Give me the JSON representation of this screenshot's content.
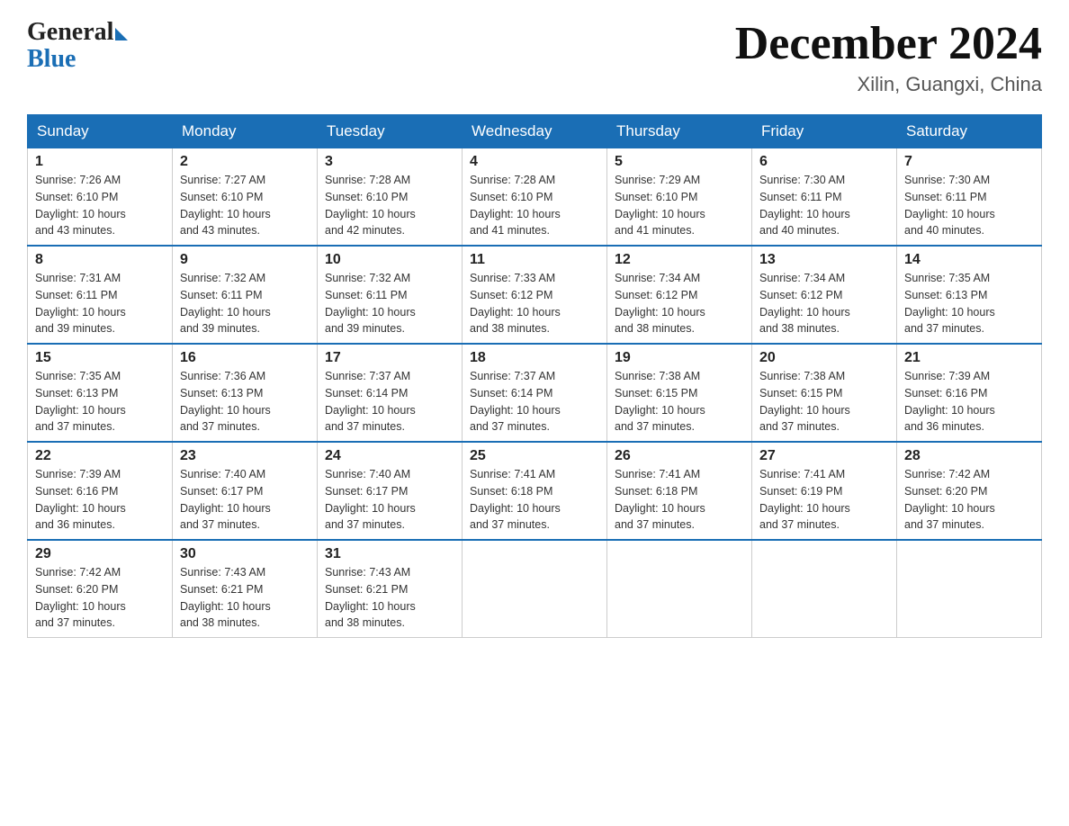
{
  "header": {
    "logo_general": "General",
    "logo_blue": "Blue",
    "month_title": "December 2024",
    "location": "Xilin, Guangxi, China"
  },
  "weekdays": [
    "Sunday",
    "Monday",
    "Tuesday",
    "Wednesday",
    "Thursday",
    "Friday",
    "Saturday"
  ],
  "weeks": [
    [
      {
        "day": "1",
        "sunrise": "7:26 AM",
        "sunset": "6:10 PM",
        "daylight": "10 hours and 43 minutes."
      },
      {
        "day": "2",
        "sunrise": "7:27 AM",
        "sunset": "6:10 PM",
        "daylight": "10 hours and 43 minutes."
      },
      {
        "day": "3",
        "sunrise": "7:28 AM",
        "sunset": "6:10 PM",
        "daylight": "10 hours and 42 minutes."
      },
      {
        "day": "4",
        "sunrise": "7:28 AM",
        "sunset": "6:10 PM",
        "daylight": "10 hours and 41 minutes."
      },
      {
        "day": "5",
        "sunrise": "7:29 AM",
        "sunset": "6:10 PM",
        "daylight": "10 hours and 41 minutes."
      },
      {
        "day": "6",
        "sunrise": "7:30 AM",
        "sunset": "6:11 PM",
        "daylight": "10 hours and 40 minutes."
      },
      {
        "day": "7",
        "sunrise": "7:30 AM",
        "sunset": "6:11 PM",
        "daylight": "10 hours and 40 minutes."
      }
    ],
    [
      {
        "day": "8",
        "sunrise": "7:31 AM",
        "sunset": "6:11 PM",
        "daylight": "10 hours and 39 minutes."
      },
      {
        "day": "9",
        "sunrise": "7:32 AM",
        "sunset": "6:11 PM",
        "daylight": "10 hours and 39 minutes."
      },
      {
        "day": "10",
        "sunrise": "7:32 AM",
        "sunset": "6:11 PM",
        "daylight": "10 hours and 39 minutes."
      },
      {
        "day": "11",
        "sunrise": "7:33 AM",
        "sunset": "6:12 PM",
        "daylight": "10 hours and 38 minutes."
      },
      {
        "day": "12",
        "sunrise": "7:34 AM",
        "sunset": "6:12 PM",
        "daylight": "10 hours and 38 minutes."
      },
      {
        "day": "13",
        "sunrise": "7:34 AM",
        "sunset": "6:12 PM",
        "daylight": "10 hours and 38 minutes."
      },
      {
        "day": "14",
        "sunrise": "7:35 AM",
        "sunset": "6:13 PM",
        "daylight": "10 hours and 37 minutes."
      }
    ],
    [
      {
        "day": "15",
        "sunrise": "7:35 AM",
        "sunset": "6:13 PM",
        "daylight": "10 hours and 37 minutes."
      },
      {
        "day": "16",
        "sunrise": "7:36 AM",
        "sunset": "6:13 PM",
        "daylight": "10 hours and 37 minutes."
      },
      {
        "day": "17",
        "sunrise": "7:37 AM",
        "sunset": "6:14 PM",
        "daylight": "10 hours and 37 minutes."
      },
      {
        "day": "18",
        "sunrise": "7:37 AM",
        "sunset": "6:14 PM",
        "daylight": "10 hours and 37 minutes."
      },
      {
        "day": "19",
        "sunrise": "7:38 AM",
        "sunset": "6:15 PM",
        "daylight": "10 hours and 37 minutes."
      },
      {
        "day": "20",
        "sunrise": "7:38 AM",
        "sunset": "6:15 PM",
        "daylight": "10 hours and 37 minutes."
      },
      {
        "day": "21",
        "sunrise": "7:39 AM",
        "sunset": "6:16 PM",
        "daylight": "10 hours and 36 minutes."
      }
    ],
    [
      {
        "day": "22",
        "sunrise": "7:39 AM",
        "sunset": "6:16 PM",
        "daylight": "10 hours and 36 minutes."
      },
      {
        "day": "23",
        "sunrise": "7:40 AM",
        "sunset": "6:17 PM",
        "daylight": "10 hours and 37 minutes."
      },
      {
        "day": "24",
        "sunrise": "7:40 AM",
        "sunset": "6:17 PM",
        "daylight": "10 hours and 37 minutes."
      },
      {
        "day": "25",
        "sunrise": "7:41 AM",
        "sunset": "6:18 PM",
        "daylight": "10 hours and 37 minutes."
      },
      {
        "day": "26",
        "sunrise": "7:41 AM",
        "sunset": "6:18 PM",
        "daylight": "10 hours and 37 minutes."
      },
      {
        "day": "27",
        "sunrise": "7:41 AM",
        "sunset": "6:19 PM",
        "daylight": "10 hours and 37 minutes."
      },
      {
        "day": "28",
        "sunrise": "7:42 AM",
        "sunset": "6:20 PM",
        "daylight": "10 hours and 37 minutes."
      }
    ],
    [
      {
        "day": "29",
        "sunrise": "7:42 AM",
        "sunset": "6:20 PM",
        "daylight": "10 hours and 37 minutes."
      },
      {
        "day": "30",
        "sunrise": "7:43 AM",
        "sunset": "6:21 PM",
        "daylight": "10 hours and 38 minutes."
      },
      {
        "day": "31",
        "sunrise": "7:43 AM",
        "sunset": "6:21 PM",
        "daylight": "10 hours and 38 minutes."
      },
      null,
      null,
      null,
      null
    ]
  ],
  "labels": {
    "sunrise": "Sunrise:",
    "sunset": "Sunset:",
    "daylight": "Daylight:"
  }
}
